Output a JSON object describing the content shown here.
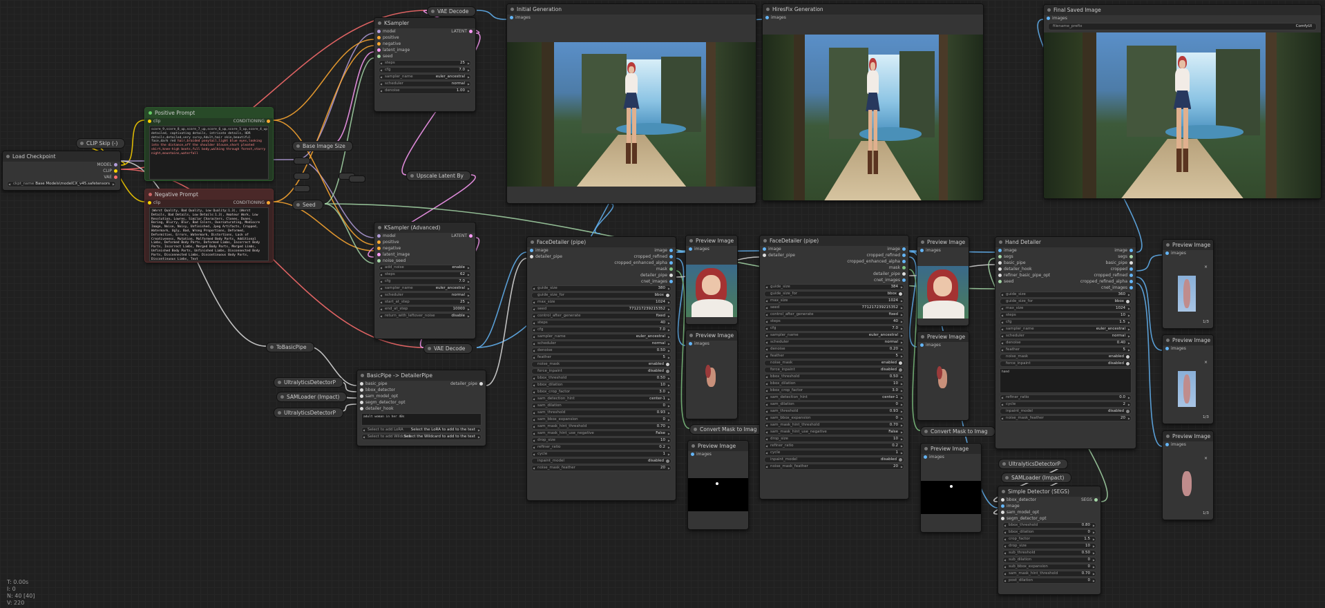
{
  "nodes": {
    "load_checkpoint": {
      "title": "Load Checkpoint",
      "outputs": [
        "MODEL",
        "CLIP",
        "VAE"
      ],
      "widget_label": "ckpt_name",
      "widget_value": "Base Models\\modelCX_v45.safetensors"
    },
    "clip_skip": {
      "title": "CLIP Skip (-)"
    },
    "positive_prompt": {
      "title": "Positive Prompt",
      "input": "clip",
      "output": "CONDITIONING",
      "text_normal": "score_9,score_8_up,score_7_up,score_6_up,score_5_up,score_4_up, detailed, captivating details, intricate details, HDR details,detailed,very curvy,Adult,hair skin,beautiful face,dark red ",
      "text_highlight": "hair,braided ponytail,light blue eyes,looking into the distance,off the shoulder blouse,short pleated skirt,knee-high boots,full body,walking through forest,starry night,mountains,waterfall"
    },
    "negative_prompt": {
      "title": "Negative Prompt",
      "input": "clip",
      "output": "CONDITIONING",
      "text": "(Worst Quality, Bad Quality, Low Quality:1.3), (Worst Details, Bad Details, Low Details:1.3), Amateur Work, Low Resolution, Lowres, Similar Characters, Clones, Dunes, Boring, Blurry, Blur, Bad Colors, Oversaturating, Mediocre Image, Noise, Noisy, Unfinished, Jpeg Artifacts, Cropped, Watermark, Ugly, Bad, Wrong Proportions, Deformed, Deformities, Errors, Watermark, Distortions, Lack of Creativeness, Mutation, Malformed Body Parts, Additional Limbs, Deformed Body Parts, Deformed Limbs, Incorrect Body Parts, Incorrect Limbs, Merged Body Parts, Merged Limbs, Unfinished Body Parts, Unfinished Limbs, Disconnected Body Parts, Disconnected Limbs, Discontinuous Body Parts, Discontinuous Limbs, Text"
    },
    "base_image_size": {
      "title": "Base Image Size"
    },
    "seed": {
      "title": "Seed"
    },
    "vae_decode_top": {
      "title": "VAE Decode"
    },
    "ksampler": {
      "title": "KSampler",
      "inputs": [
        "model",
        "positive",
        "negative",
        "latent_image",
        "seed"
      ],
      "output": "LATENT",
      "widgets": [
        {
          "label": "steps",
          "value": "25"
        },
        {
          "label": "cfg",
          "value": "7.0"
        },
        {
          "label": "sampler_name",
          "value": "euler_ancestral"
        },
        {
          "label": "scheduler",
          "value": "normal"
        },
        {
          "label": "denoise",
          "value": "1.00"
        }
      ]
    },
    "upscale_latent": {
      "title": "Upscale Latent By"
    },
    "ksampler_adv": {
      "title": "KSampler (Advanced)",
      "inputs": [
        "model",
        "positive",
        "negative",
        "latent_image",
        "noise_seed"
      ],
      "output": "LATENT",
      "widgets": [
        {
          "label": "add_noise",
          "value": "enable"
        },
        {
          "label": "steps",
          "value": "62"
        },
        {
          "label": "cfg",
          "value": "7.0"
        },
        {
          "label": "sampler_name",
          "value": "euler_ancestral"
        },
        {
          "label": "scheduler",
          "value": "normal"
        },
        {
          "label": "start_at_step",
          "value": "25"
        },
        {
          "label": "end_at_step",
          "value": "10000"
        },
        {
          "label": "return_with_leftover_noise",
          "value": "disable"
        }
      ]
    },
    "vae_decode_mid": {
      "title": "VAE Decode"
    },
    "to_basic_pipe": {
      "title": "ToBasicPipe"
    },
    "ultra_det_1": {
      "title": "UltralyticsDetectorP"
    },
    "sam_loader_1": {
      "title": "SAMLoader (Impact)"
    },
    "ultra_det_2": {
      "title": "UltralyticsDetectorP"
    },
    "basic_to_detailer": {
      "title": "BasicPipe -> DetailerPipe",
      "inputs": [
        "basic_pipe",
        "bbox_detector",
        "sam_model_opt",
        "segm_detector_opt",
        "detailer_hook"
      ],
      "output": "detailer_pipe",
      "text": "adult woman in her 40s",
      "lora_label": "Select to add LoRA",
      "lora_value": "Select the LoRA to add to the text",
      "wildcard_label": "Select to add Wildcard",
      "wildcard_value": "Select the Wildcard to add to the text"
    },
    "initial_gen": {
      "title": "Initial Generation",
      "input": "images"
    },
    "hires_gen": {
      "title": "HiresFix Generation",
      "input": "images"
    },
    "final_saved": {
      "title": "Final Saved Image",
      "input": "images",
      "prefix_label": "filename_prefix",
      "prefix_value": "ComfyUI"
    },
    "face_detailer_1": {
      "title": "FaceDetailer (pipe)",
      "inputs": [
        "image",
        "detailer_pipe"
      ],
      "outputs": [
        "image",
        "cropped_refined",
        "cropped_enhanced_alpha",
        "mask",
        "detailer_pipe",
        "cnet_images"
      ],
      "widgets": [
        {
          "label": "guide_size",
          "value": "380"
        },
        {
          "label": "guide_size_for",
          "value": "bbox",
          "toggle": true,
          "on": true
        },
        {
          "label": "max_size",
          "value": "1024"
        },
        {
          "label": "seed",
          "value": "771217239215352"
        },
        {
          "label": "control_after_generate",
          "value": "fixed"
        },
        {
          "label": "steps",
          "value": "40"
        },
        {
          "label": "cfg",
          "value": "7.0"
        },
        {
          "label": "sampler_name",
          "value": "euler_ancestral"
        },
        {
          "label": "scheduler",
          "value": "normal"
        },
        {
          "label": "denoise",
          "value": "0.50"
        },
        {
          "label": "feather",
          "value": "5"
        },
        {
          "label": "noise_mask",
          "value": "enabled",
          "toggle": true,
          "on": true
        },
        {
          "label": "force_inpaint",
          "value": "disabled",
          "toggle": true,
          "on": false
        },
        {
          "label": "bbox_threshold",
          "value": "0.50"
        },
        {
          "label": "bbox_dilation",
          "value": "10"
        },
        {
          "label": "bbox_crop_factor",
          "value": "3.0"
        },
        {
          "label": "sam_detection_hint",
          "value": "center-1"
        },
        {
          "label": "sam_dilation",
          "value": "0"
        },
        {
          "label": "sam_threshold",
          "value": "0.93"
        },
        {
          "label": "sam_bbox_expansion",
          "value": "0"
        },
        {
          "label": "sam_mask_hint_threshold",
          "value": "0.70"
        },
        {
          "label": "sam_mask_hint_use_negative",
          "value": "False"
        },
        {
          "label": "drop_size",
          "value": "10"
        },
        {
          "label": "refiner_ratio",
          "value": "0.2"
        },
        {
          "label": "cycle",
          "value": "1"
        },
        {
          "label": "inpaint_model",
          "value": "disabled",
          "toggle": true,
          "on": false
        },
        {
          "label": "noise_mask_feather",
          "value": "20"
        }
      ]
    },
    "preview_a": {
      "title": "Preview Image",
      "input": "images"
    },
    "preview_b": {
      "title": "Preview Image",
      "input": "images"
    },
    "convert_mask_1": {
      "title": "Convert Mask to Imag"
    },
    "preview_c": {
      "title": "Preview Image",
      "input": "images"
    },
    "face_detailer_2": {
      "title": "FaceDetailer (pipe)",
      "inputs": [
        "image",
        "detailer_pipe"
      ],
      "outputs": [
        "image",
        "cropped_refined",
        "cropped_enhanced_alpha",
        "mask",
        "detailer_pipe",
        "cnet_images"
      ],
      "widgets": [
        {
          "label": "guide_size",
          "value": "384"
        },
        {
          "label": "guide_size_for",
          "value": "bbox",
          "toggle": true,
          "on": true
        },
        {
          "label": "max_size",
          "value": "1024"
        },
        {
          "label": "seed",
          "value": "771217239215352"
        },
        {
          "label": "control_after_generate",
          "value": "fixed"
        },
        {
          "label": "steps",
          "value": "40"
        },
        {
          "label": "cfg",
          "value": "7.0"
        },
        {
          "label": "sampler_name",
          "value": "euler_ancestral"
        },
        {
          "label": "scheduler",
          "value": "normal"
        },
        {
          "label": "denoise",
          "value": "0.20"
        },
        {
          "label": "feather",
          "value": "5"
        },
        {
          "label": "noise_mask",
          "value": "enabled",
          "toggle": true,
          "on": true
        },
        {
          "label": "force_inpaint",
          "value": "disabled",
          "toggle": true,
          "on": false
        },
        {
          "label": "bbox_threshold",
          "value": "0.50"
        },
        {
          "label": "bbox_dilation",
          "value": "10"
        },
        {
          "label": "bbox_crop_factor",
          "value": "3.0"
        },
        {
          "label": "sam_detection_hint",
          "value": "center-1"
        },
        {
          "label": "sam_dilation",
          "value": "0"
        },
        {
          "label": "sam_threshold",
          "value": "0.93"
        },
        {
          "label": "sam_bbox_expansion",
          "value": "0"
        },
        {
          "label": "sam_mask_hint_threshold",
          "value": "0.70"
        },
        {
          "label": "sam_mask_hint_use_negative",
          "value": "False"
        },
        {
          "label": "drop_size",
          "value": "10"
        },
        {
          "label": "refiner_ratio",
          "value": "0.2"
        },
        {
          "label": "cycle",
          "value": "1"
        },
        {
          "label": "inpaint_model",
          "value": "disabled",
          "toggle": true,
          "on": false
        },
        {
          "label": "noise_mask_feather",
          "value": "20"
        }
      ]
    },
    "preview_d": {
      "title": "Preview Image",
      "input": "images"
    },
    "preview_e": {
      "title": "Preview Image",
      "input": "images"
    },
    "convert_mask_2": {
      "title": "Convert Mask to Imag"
    },
    "preview_f": {
      "title": "Preview Image",
      "input": "images"
    },
    "hand_detailer": {
      "title": "Hand Detailer",
      "inputs": [
        "image",
        "segs",
        "basic_pipe",
        "detailer_hook",
        "refiner_basic_pipe_opt",
        "seed"
      ],
      "outputs": [
        "image",
        "segs",
        "basic_pipe",
        "cropped",
        "cropped_refined",
        "cropped_refined_alpha",
        "cnet_images"
      ],
      "widgets": [
        {
          "label": "guide_size",
          "value": "360"
        },
        {
          "label": "guide_size_for",
          "value": "bbox",
          "toggle": true,
          "on": true
        },
        {
          "label": "max_size",
          "value": "1024"
        },
        {
          "label": "steps",
          "value": "10"
        },
        {
          "label": "cfg",
          "value": "1.5"
        },
        {
          "label": "sampler_name",
          "value": "euler_ancestral"
        },
        {
          "label": "scheduler",
          "value": "normal"
        },
        {
          "label": "denoise",
          "value": "0.40"
        },
        {
          "label": "feather",
          "value": "5"
        },
        {
          "label": "noise_mask",
          "value": "enabled",
          "toggle": true,
          "on": true
        },
        {
          "label": "force_inpaint",
          "value": "disabled",
          "toggle": true,
          "on": true
        }
      ],
      "text": "hand",
      "widgets2": [
        {
          "label": "refiner_ratio",
          "value": "0.0"
        },
        {
          "label": "cycle",
          "value": "2"
        },
        {
          "label": "inpaint_model",
          "value": "disabled",
          "toggle": true,
          "on": false
        },
        {
          "label": "noise_mask_feather",
          "value": "20"
        }
      ]
    },
    "preview_h1": {
      "title": "Preview Image",
      "input": "images",
      "counter": "1/3"
    },
    "preview_h2": {
      "title": "Preview Image",
      "input": "images",
      "counter": "1/3"
    },
    "preview_h3": {
      "title": "Preview Image",
      "input": "images",
      "counter": "1/3"
    },
    "ultra_det_3": {
      "title": "UltralyticsDetectorP"
    },
    "sam_loader_2": {
      "title": "SAMLoader (Impact)"
    },
    "simple_detector": {
      "title": "Simple Detector (SEGS)",
      "inputs": [
        "bbox_detector",
        "image",
        "sam_model_opt",
        "segm_detector_opt"
      ],
      "output": "SEGS",
      "widgets": [
        {
          "label": "bbox_threshold",
          "value": "0.80"
        },
        {
          "label": "bbox_dilation",
          "value": "0"
        },
        {
          "label": "crop_factor",
          "value": "1.5"
        },
        {
          "label": "drop_size",
          "value": "10"
        },
        {
          "label": "sub_threshold",
          "value": "0.50"
        },
        {
          "label": "sub_dilation",
          "value": "0"
        },
        {
          "label": "sub_bbox_expansion",
          "value": "0"
        },
        {
          "label": "sam_mask_hint_threshold",
          "value": "0.70"
        },
        {
          "label": "post_dilation",
          "value": "0"
        }
      ]
    }
  },
  "stats": [
    "T: 0.00s",
    "I: 0",
    "N: 40 [40]",
    "V: 220"
  ],
  "colors": {
    "model": "#b39ddb",
    "clip": "#ffd500",
    "vae": "#ff6e6e",
    "conditioning": "#ffa931",
    "latent": "#ff9cf9",
    "image": "#64b5f6",
    "pipe": "#dddddd",
    "int": "#a5d6a7",
    "mask": "#81c784"
  }
}
